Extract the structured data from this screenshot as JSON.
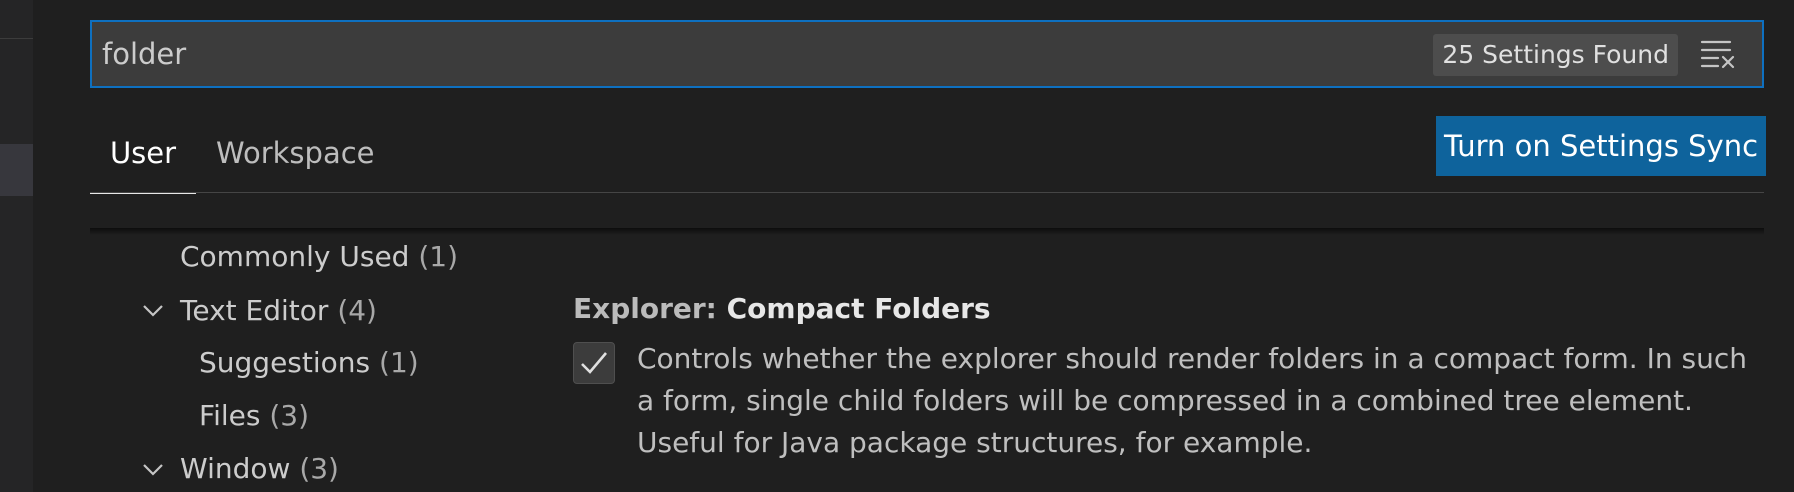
{
  "search": {
    "value": "folder",
    "results_badge": "25 Settings Found",
    "clear_icon": "clear-filter-icon"
  },
  "tabs": [
    {
      "label": "User",
      "active": true
    },
    {
      "label": "Workspace",
      "active": false
    }
  ],
  "sync_button": {
    "label": "Turn on Settings Sync"
  },
  "toc": {
    "commonly_used": {
      "label": "Commonly Used",
      "count": "(1)"
    },
    "text_editor": {
      "label": "Text Editor",
      "count": "(4)",
      "expanded": true
    },
    "suggestions": {
      "label": "Suggestions",
      "count": "(1)"
    },
    "files": {
      "label": "Files",
      "count": "(3)"
    },
    "window": {
      "label": "Window",
      "count": "(3)",
      "expanded": true
    }
  },
  "setting": {
    "category": "Explorer: ",
    "name": "Compact Folders",
    "checked": true,
    "description": "Controls whether the explorer should render folders in a compact form. In such a form, single child folders will be compressed in a combined tree element. Useful for Java package structures, for example."
  },
  "colors": {
    "accent": "#0e70c0",
    "button": "#0e639c",
    "background": "#1f1f1f"
  }
}
